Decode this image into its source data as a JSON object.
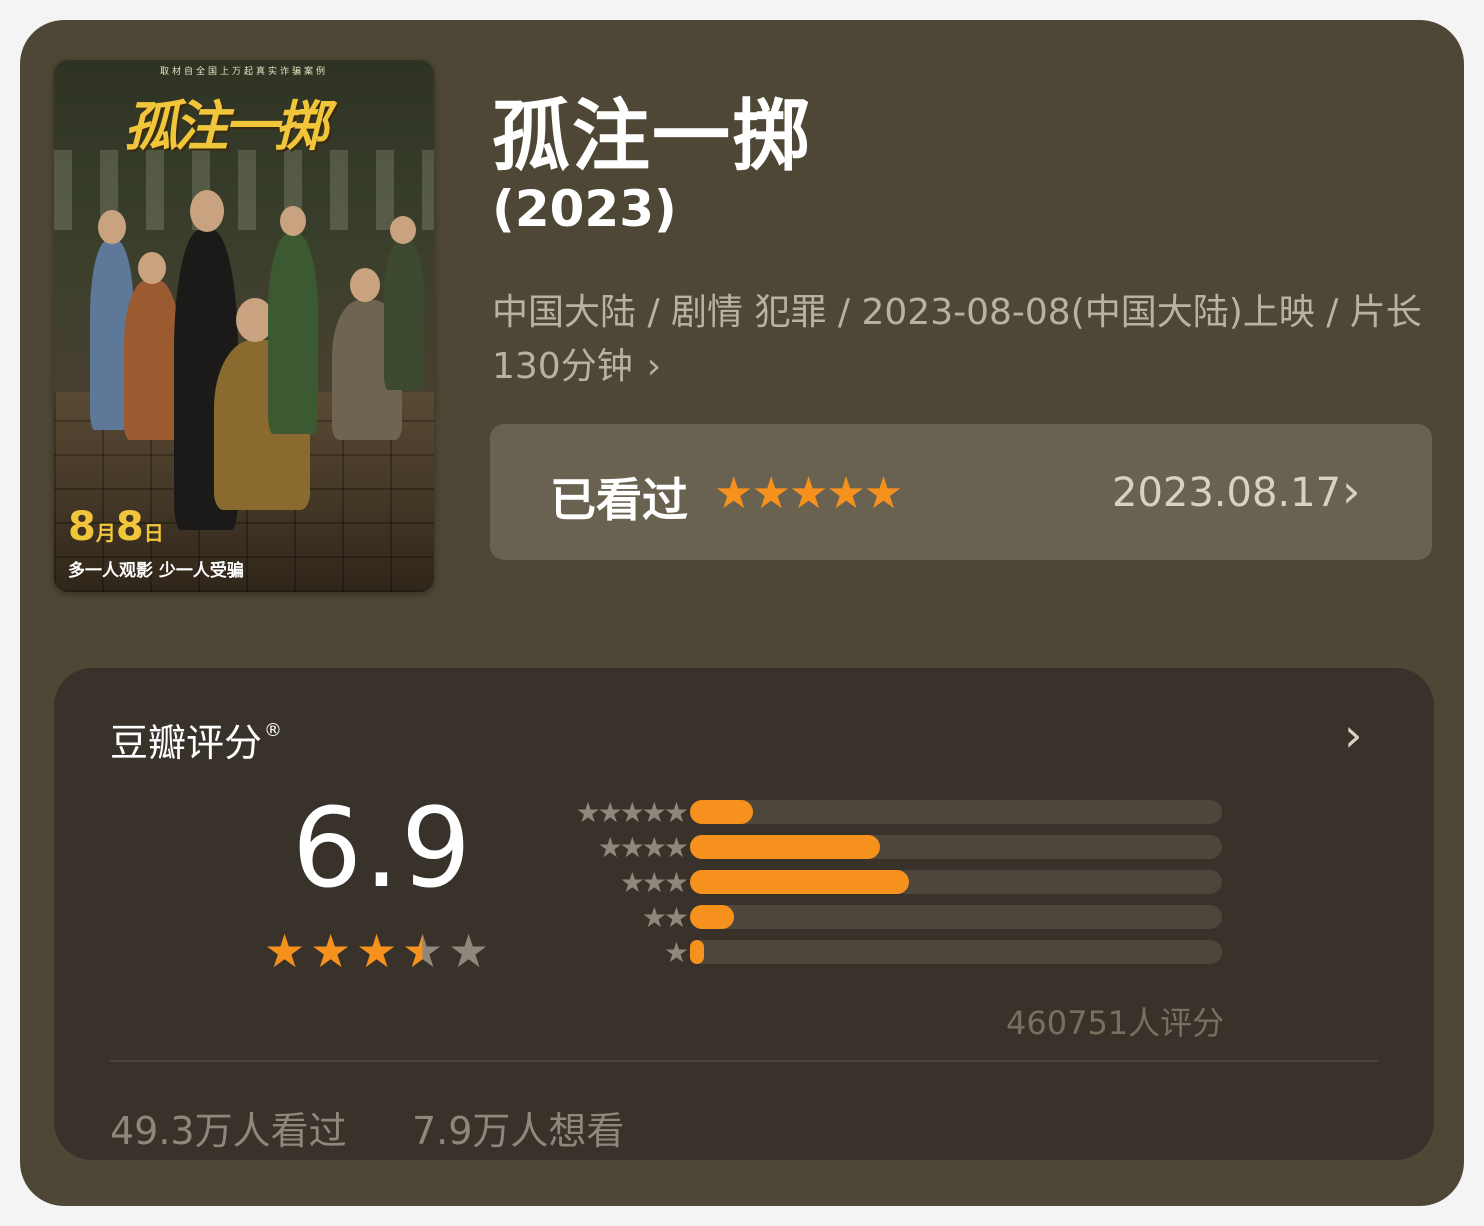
{
  "movie": {
    "title": "孤注一掷",
    "year": "(2023)",
    "meta": "中国大陆 / 剧情 犯罪 / 2023-08-08(中国大陆)上映 / 片长130分钟",
    "meta_chevron": "›"
  },
  "poster": {
    "tagline_top": "取材自全国上万起真实诈骗案例",
    "title": "孤注一掷",
    "date_num1": "8",
    "date_month": "月",
    "date_num2": "8",
    "date_day": "日",
    "slogan": "多一人观影 少一人受骗"
  },
  "watched": {
    "label": "已看过",
    "stars": "★★★★★",
    "date": "2023.08.17",
    "chevron": "›"
  },
  "rating": {
    "label": "豆瓣评分",
    "registered_mark": "®",
    "chevron": "›",
    "score": "6.9",
    "star_rating": 3.5,
    "distribution": [
      {
        "stars": "★★★★★",
        "percent": 11.8
      },
      {
        "stars": "★★★★",
        "percent": 35.7
      },
      {
        "stars": "★★★",
        "percent": 41.2
      },
      {
        "stars": "★★",
        "percent": 8.2
      },
      {
        "stars": "★",
        "percent": 2.6
      }
    ],
    "count": "460751人评分",
    "seen": "49.3万人看过",
    "want": "7.9万人想看"
  },
  "colors": {
    "accent_orange": "#f6911e",
    "card_bg": "#4f4735",
    "panel_bg": "#38322a",
    "star_empty": "#8e877a"
  }
}
